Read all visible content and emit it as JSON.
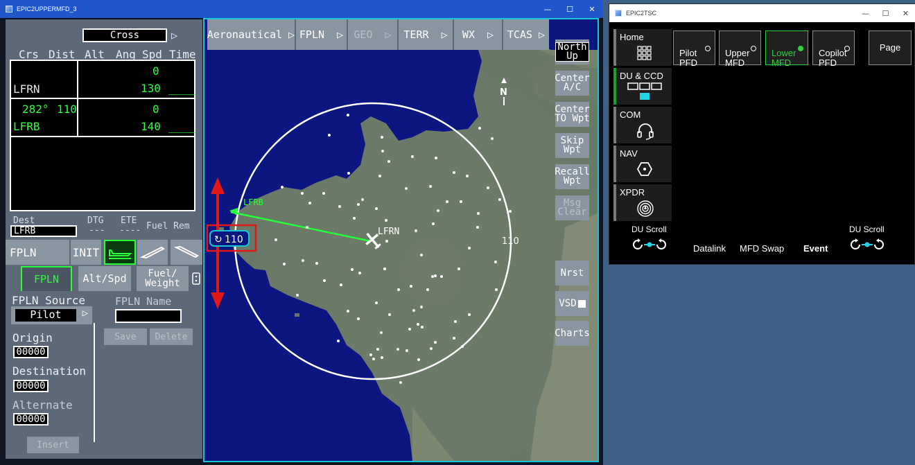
{
  "mfd_window": {
    "title": "EPIC2UPPERMFD_3",
    "controls": {
      "minimize": "—",
      "maximize": "☐",
      "close": "✕"
    }
  },
  "fms": {
    "course_mode": "Cross",
    "headers": {
      "crs": "Crs",
      "dist": "Dist",
      "alt": "Alt",
      "ang": "Ang",
      "spd": "Spd",
      "time": "Time"
    },
    "legs": [
      {
        "waypoint": "LFRN",
        "crs": "",
        "dist": "",
        "alt": "0",
        "spd": "130",
        "time": "____"
      },
      {
        "waypoint": "LFRB",
        "crs": "282°",
        "dist": "110",
        "alt": "0",
        "spd": "140",
        "time": "____"
      }
    ],
    "dest_label": "Dest",
    "dest_value": "LFRB",
    "dtg_label": "DTG",
    "dtg_value": "---",
    "ete_label": "ETE",
    "ete_value": "----",
    "fuel_rem_label": "Fuel Rem",
    "tabs": {
      "fpln": "FPLN",
      "init": "INIT"
    },
    "subtabs": {
      "fpln": "FPLN",
      "alt_spd": "Alt/Spd",
      "fuel_weight": "Fuel/\nWeight"
    },
    "fpln_source_label": "FPLN Source",
    "fpln_source_value": "Pilot",
    "fpln_name_label": "FPLN Name",
    "origin_label": "Origin",
    "origin_value": "00000",
    "destination_label": "Destination",
    "destination_value": "00000",
    "alternate_label": "Alternate",
    "alternate_value": "00000",
    "save_label": "Save",
    "delete_label": "Delete",
    "insert_label": "Insert"
  },
  "map": {
    "tabs": [
      "Aeronautical",
      "FPLN",
      "GEO",
      "TERR",
      "WX",
      "TCAS"
    ],
    "range_label": "110",
    "range_ring_label": "110",
    "north_indicator": "N",
    "waypoints": {
      "origin": "LFRN",
      "dest": "LFRB"
    },
    "side_buttons": {
      "north_up": "North\nUp",
      "center_ac": "Center\nA/C",
      "center_to_wpt": "Center\nTO Wpt",
      "skip_wpt": "Skip\nWpt",
      "recall_wpt": "Recall\nWpt",
      "msg_clear": "Msg\nClear",
      "nrst": "Nrst",
      "vsd": "VSD",
      "charts": "Charts"
    }
  },
  "tsc_window": {
    "title": "EPIC2TSC",
    "nav": [
      "Home",
      "DU & CCD",
      "COM",
      "NAV",
      "XPDR"
    ],
    "du_buttons": [
      {
        "label": "Pilot\nPFD",
        "selected": false
      },
      {
        "label": "Upper\nMFD",
        "selected": false
      },
      {
        "label": "Lower\nMFD",
        "selected": true
      },
      {
        "label": "Copilot\nPFD",
        "selected": false
      }
    ],
    "page_label": "Page",
    "du_scroll_left": "DU Scroll",
    "du_scroll_right": "DU Scroll",
    "datalink": "Datalink",
    "mfd_swap": "MFD Swap",
    "event": "Event"
  },
  "colors": {
    "accent_green": "#27ff3a",
    "cyan_border": "#19c6d6",
    "sea": "#0b1680",
    "land": "#6f7d6c",
    "alert_red": "#e01818"
  }
}
